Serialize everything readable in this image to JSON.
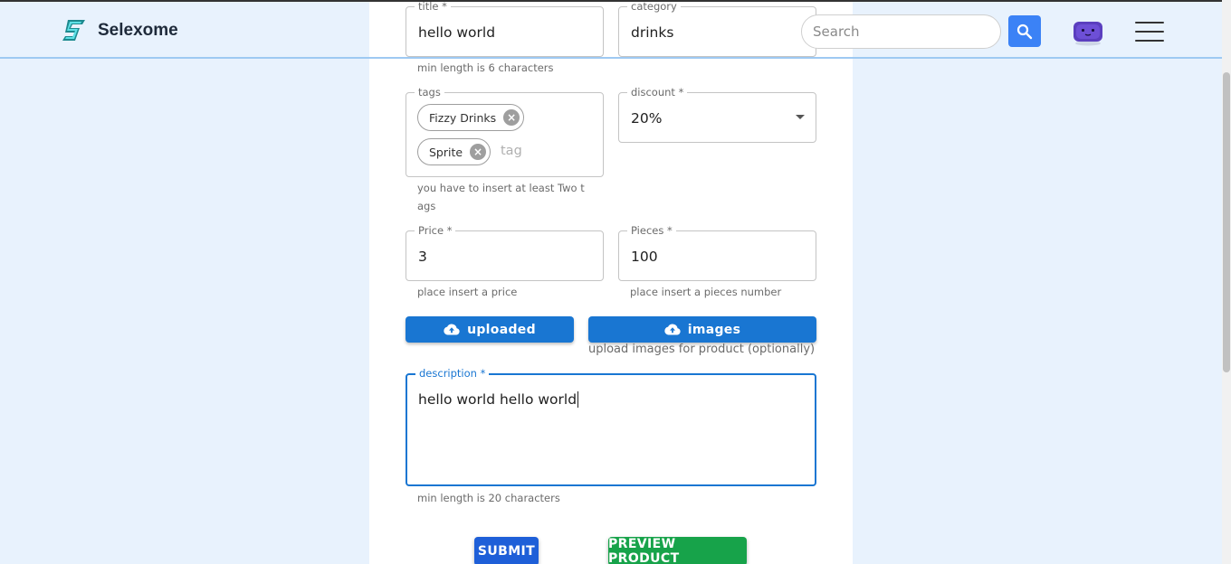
{
  "header": {
    "brand_name": "Selexome",
    "search_placeholder": "Search",
    "logo_icon": "lightning-s-icon",
    "avatar_icon": "purple-robot-avatar",
    "menu_icon": "hamburger-menu-icon"
  },
  "form": {
    "title": {
      "label": "title *",
      "value": "hello world",
      "helper": "min length is 6 characters"
    },
    "category": {
      "label": "category",
      "value": "drinks"
    },
    "tags": {
      "label": "tags",
      "chips": [
        "Fizzy Drinks",
        "Sprite"
      ],
      "input_placeholder": "tag",
      "helper_line1": "you have to insert at least Two t",
      "helper_line2": "ags"
    },
    "discount": {
      "label": "discount *",
      "value": "20%"
    },
    "price": {
      "label": "Price *",
      "value": "3",
      "helper": "place insert a price"
    },
    "pieces": {
      "label": "Pieces *",
      "value": "100",
      "helper": "place insert a pieces number"
    },
    "upload_main_label": "uploaded",
    "upload_images_label": "images",
    "upload_images_helper": "upload images for product (optionally)",
    "description": {
      "label": "description *",
      "value": "hello world hello world",
      "helper": "min length is 20 characters"
    },
    "submit_label": "SUBMIT",
    "preview_label": "PREVIEW PRODUCT"
  },
  "colors": {
    "page_background": "#e8f2fd",
    "primary": "#1976d2",
    "search_button": "#3b82f6",
    "submit": "#1e5fd8",
    "preview": "#17a34a",
    "focus_border": "#1976d2"
  }
}
